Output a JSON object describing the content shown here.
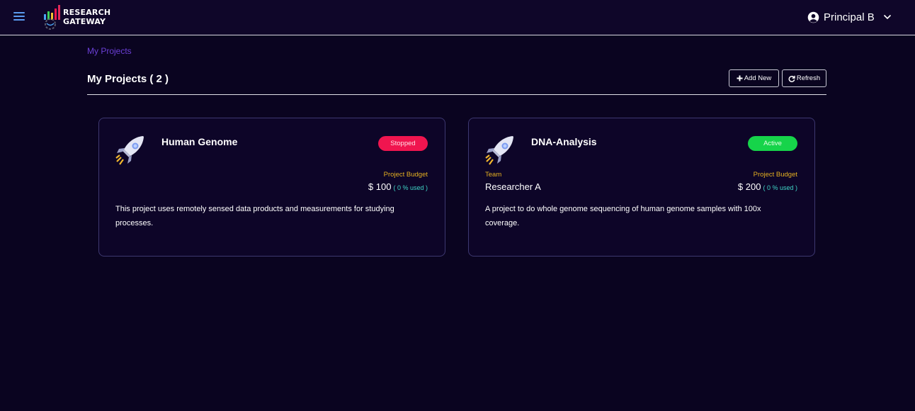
{
  "header": {
    "logo_text": "RESEARCH\nGATEWAY",
    "user_name": "Principal B"
  },
  "breadcrumb": "My Projects",
  "page": {
    "title": "My Projects ( 2 )",
    "add_label": "Add New",
    "refresh_label": "Refresh"
  },
  "projects": [
    {
      "name": "Human Genome",
      "status": "Stopped",
      "budget_label": "Project Budget",
      "budget_value": "$ 100",
      "budget_used": "( 0 % used )",
      "description": "This project uses remotely sensed data products and measurements for studying processes."
    },
    {
      "name": "DNA-Analysis",
      "status": "Active",
      "team_label": "Team",
      "team_value": "Researcher A",
      "budget_label": "Project Budget",
      "budget_value": "$ 200",
      "budget_used": "( 0 % used )",
      "description": "A project to do whole genome sequencing of human genome samples with 100x coverage."
    }
  ],
  "colors": {
    "background": "#0a0420",
    "accent_link": "#6b3fd6",
    "stopped": "#f0154f",
    "active": "#16d44a",
    "label": "#e5b021",
    "used": "#3fd6c7"
  },
  "icons": [
    "hamburger-menu-icon",
    "account-circle-icon",
    "chevron-down-icon",
    "plus-icon",
    "refresh-icon",
    "rocket-icon"
  ]
}
